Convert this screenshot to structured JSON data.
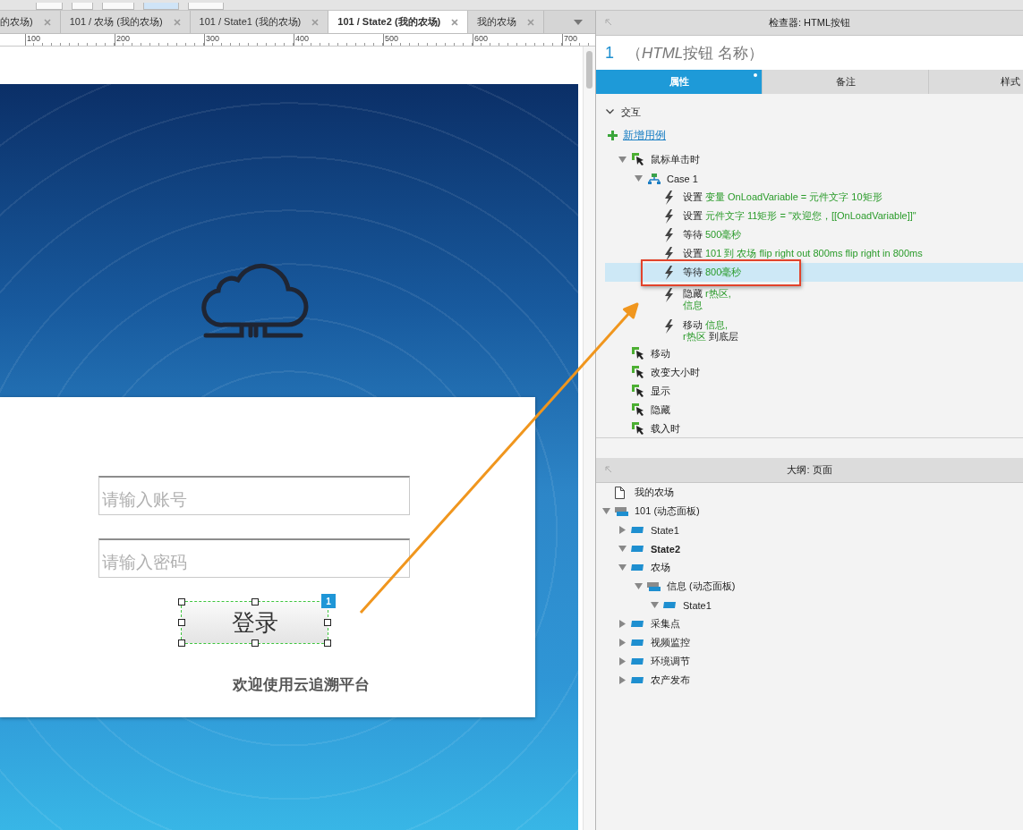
{
  "doc_tabs": [
    {
      "label": "的农场)",
      "selected": false
    },
    {
      "label": "101 / 农场 (我的农场)",
      "selected": false
    },
    {
      "label": "101 / State1 (我的农场)",
      "selected": false
    },
    {
      "label": "101 / State2 (我的农场)",
      "selected": true
    },
    {
      "label": "我的农场",
      "selected": false
    }
  ],
  "ruler": {
    "labels": [
      "100",
      "200",
      "300",
      "400",
      "500",
      "600",
      "700"
    ]
  },
  "canvas": {
    "fields": [
      {
        "placeholder": "请输入账号"
      },
      {
        "placeholder": "请输入密码"
      }
    ],
    "login_button": {
      "label": "登录",
      "badge": "1"
    },
    "welcome": "欢迎使用云追溯平台"
  },
  "inspector": {
    "title": "检查器: HTML按钮",
    "widget_name": "1",
    "widget_type": [
      {
        "kind": "plain",
        "text": "（"
      },
      {
        "kind": "widget_class",
        "text": "HTML"
      },
      {
        "kind": "plain",
        "text": "按钮 名称）"
      }
    ],
    "tabs": [
      {
        "label": "属性",
        "selected": true,
        "modified": true
      },
      {
        "label": "备注",
        "selected": false,
        "modified": false
      },
      {
        "label": "样式",
        "selected": false,
        "modified": false
      }
    ],
    "section": {
      "label": "交互",
      "expanded": true
    },
    "add_case": "新增用例",
    "events": [
      {
        "label": "鼠标单击时",
        "expanded": true,
        "cases": [
          {
            "label": "Case 1",
            "expanded": true,
            "actions": [
              {
                "selected": false,
                "lines": [
                  [
                    {
                      "kind": "verb",
                      "text": "设置"
                    },
                    {
                      "kind": "target",
                      "text": "变量 OnLoadVariable = 元件文字 10矩形"
                    }
                  ]
                ]
              },
              {
                "selected": false,
                "lines": [
                  [
                    {
                      "kind": "verb",
                      "text": "设置"
                    },
                    {
                      "kind": "target",
                      "text": "元件文字 11矩形 = \"欢迎您，[[OnLoadVariable]]\""
                    }
                  ]
                ]
              },
              {
                "selected": false,
                "lines": [
                  [
                    {
                      "kind": "verb",
                      "text": "等待"
                    },
                    {
                      "kind": "target",
                      "text": "500毫秒"
                    }
                  ]
                ]
              },
              {
                "selected": false,
                "lines": [
                  [
                    {
                      "kind": "verb",
                      "text": "设置"
                    },
                    {
                      "kind": "target",
                      "text": "101 到 农场 flip right out 800ms flip right in 800ms"
                    }
                  ]
                ]
              },
              {
                "selected": true,
                "lines": [
                  [
                    {
                      "kind": "verb",
                      "text": "等待"
                    },
                    {
                      "kind": "target",
                      "text": "800毫秒"
                    }
                  ]
                ]
              },
              {
                "selected": false,
                "lines": [
                  [
                    {
                      "kind": "verb",
                      "text": "隐藏"
                    },
                    {
                      "kind": "target",
                      "text": "r热区,"
                    }
                  ],
                  [
                    {
                      "kind": "target",
                      "text": "信息"
                    }
                  ]
                ]
              },
              {
                "selected": false,
                "lines": [
                  [
                    {
                      "kind": "verb",
                      "text": "移动"
                    },
                    {
                      "kind": "target",
                      "text": "信息,"
                    }
                  ],
                  [
                    {
                      "kind": "target",
                      "text": "r热区"
                    },
                    {
                      "kind": "verb",
                      "text": "到底层"
                    }
                  ]
                ]
              }
            ]
          }
        ]
      },
      {
        "label": "移动",
        "expanded": false
      },
      {
        "label": "改变大小时",
        "expanded": false
      },
      {
        "label": "显示",
        "expanded": false
      },
      {
        "label": "隐藏",
        "expanded": false
      },
      {
        "label": "载入时",
        "expanded": false
      }
    ]
  },
  "outline": {
    "title": "大纲: 页面",
    "items": [
      {
        "kind": "page",
        "label": "我的农场"
      },
      {
        "kind": "panel",
        "label": "101 (动态面板)",
        "expanded": true,
        "current": false,
        "children": [
          {
            "kind": "state",
            "label": "State1",
            "expanded": false,
            "current": false
          },
          {
            "kind": "state",
            "label": "State2",
            "expanded": true,
            "current": true
          },
          {
            "kind": "state",
            "label": "农场",
            "expanded": true,
            "current": false,
            "children": [
              {
                "kind": "panel",
                "label": "信息 (动态面板)",
                "expanded": true,
                "current": false,
                "children": [
                  {
                    "kind": "state",
                    "label": "State1",
                    "expanded": true,
                    "current": false
                  }
                ]
              }
            ]
          },
          {
            "kind": "state",
            "label": "采集点",
            "expanded": false,
            "current": false
          },
          {
            "kind": "state",
            "label": "视频监控",
            "expanded": false,
            "current": false
          },
          {
            "kind": "state",
            "label": "环境调节",
            "expanded": false,
            "current": false
          },
          {
            "kind": "state",
            "label": "农产发布",
            "expanded": false,
            "current": false
          }
        ]
      }
    ]
  }
}
